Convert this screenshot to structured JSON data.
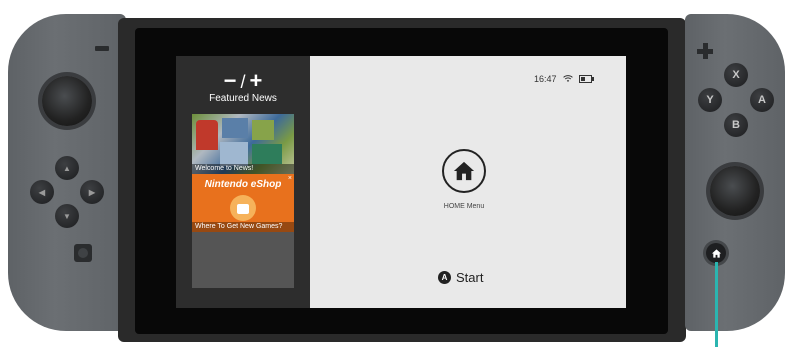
{
  "controller": {
    "face_buttons": {
      "x": "X",
      "y": "Y",
      "a": "A",
      "b": "B"
    },
    "minus_label": "−",
    "plus_label": "+",
    "dpad": {
      "up": "▲",
      "down": "▼",
      "left": "◀",
      "right": "▶"
    }
  },
  "sidebar": {
    "minus": "−",
    "slash": "/",
    "plus": "+",
    "title": "Featured News",
    "news": [
      {
        "caption": "Welcome to News!"
      },
      {
        "title": "Nintendo eShop",
        "close": "×",
        "caption": "Where To Get New Games?"
      }
    ]
  },
  "status": {
    "time": "16:47",
    "wifi_icon": "wifi-icon",
    "battery_icon": "battery-icon",
    "battery_level": 0.5
  },
  "main": {
    "home_label": "HOME Menu",
    "start_button": "A",
    "start_label": "Start"
  },
  "colors": {
    "callout": "#2bb5b0",
    "eshop": "#e8711d"
  }
}
